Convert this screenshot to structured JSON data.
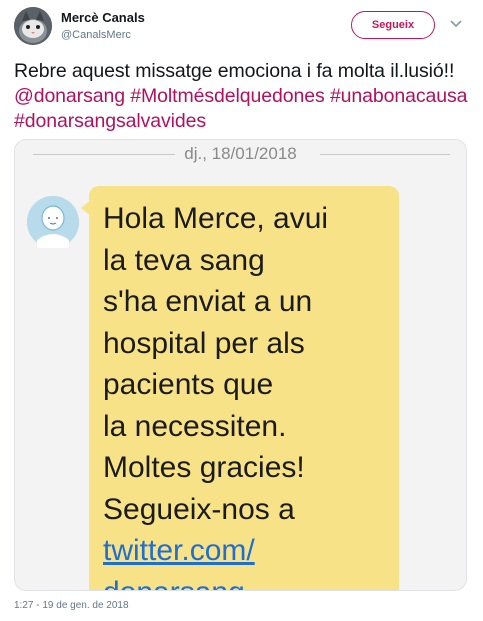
{
  "author": {
    "name": "Mercè Canals",
    "handle": "@CanalsMerc"
  },
  "follow_button": {
    "label": "Segueix"
  },
  "tweet": {
    "text_plain": "Rebre aquest missatge emociona i fa molta il.lusió!! ",
    "mention": "@donarsang",
    "hashtag1": "#Moltmésdelquedones",
    "hashtag2": "#unabonacausa",
    "hashtag3": "#donarsangsalvavides"
  },
  "sms": {
    "date": "dj., 18/01/2018",
    "message": "Hola Merce, avui\nla teva sang\ns'ha enviat a un\nhospital per als\npacients que\nla necessiten.\nMoltes gracies!\nSegueix-nos a",
    "link_line1": "twitter.com/",
    "link_line2": "donarsang"
  },
  "timestamp": "1:27 - 19 de gen. de 2018",
  "colors": {
    "accent": "#c2185b",
    "hashtag": "#b0115f",
    "bubble": "#f7e287",
    "sms_link": "#1f6fd1"
  },
  "icons": {
    "caret": "chevron-down-icon",
    "sms_avatar": "person-icon"
  }
}
